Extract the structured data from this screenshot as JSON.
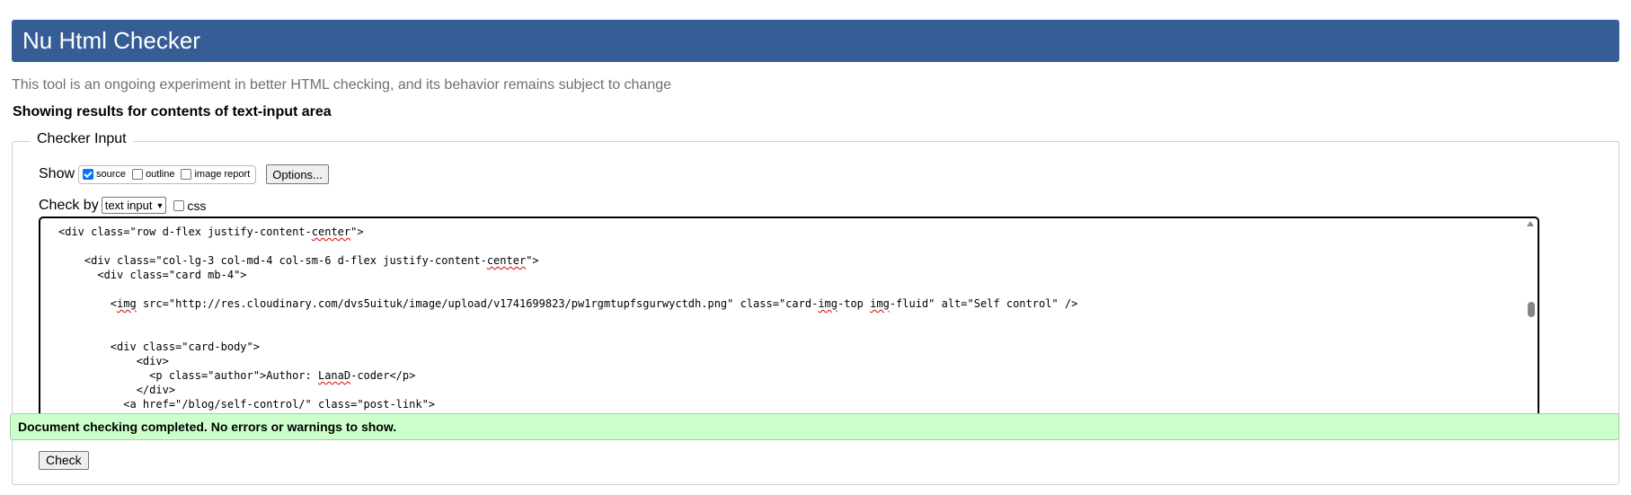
{
  "header": {
    "title": "Nu Html Checker"
  },
  "tagline": "This tool is an ongoing experiment in better HTML checking, and its behavior remains subject to change",
  "results_heading": "Showing results for contents of text-input area",
  "checker_input": {
    "legend": "Checker Input",
    "show_label": "Show",
    "show_options": [
      {
        "label": "source",
        "checked": true
      },
      {
        "label": "outline",
        "checked": false
      },
      {
        "label": "image report",
        "checked": false
      }
    ],
    "options_button": "Options...",
    "check_by_label": "Check by",
    "check_by_selected": "text input",
    "css_label": "css",
    "css_checked": false,
    "code_lines": [
      "<div class=\"row d-flex justify-content-center\">",
      "",
      "    <div class=\"col-lg-3 col-md-4 col-sm-6 d-flex justify-content-center\">",
      "      <div class=\"card mb-4\">",
      "",
      "        <img src=\"http://res.cloudinary.com/dvs5uituk/image/upload/v1741699823/pw1rgmtupfsgurwyctdh.png\" class=\"card-img-top img-fluid\" alt=\"Self control\" />",
      "",
      "",
      "        <div class=\"card-body\">",
      "            <div>",
      "              <p class=\"author\">Author: LanaD-coder</p>",
      "            </div>",
      "          <a href=\"/blog/self-control/\" class=\"post-link\">"
    ],
    "check_button": "Check"
  },
  "status_message": "Document checking completed. No errors or warnings to show.",
  "colors": {
    "header_bg": "#365d95",
    "success_bg": "#ccffcc",
    "checkbox_accent": "#0075ff"
  }
}
